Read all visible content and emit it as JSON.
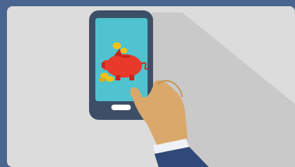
{
  "scene": {
    "icons": [
      "smartphone-icon",
      "piggy-bank-icon",
      "coin-icon",
      "hand-icon"
    ],
    "colors": {
      "frame": "#4a6590",
      "panel": "#dcdcdc",
      "shadow": "#c7c7c7",
      "phone_body": "#3d4f66",
      "screen": "#4fc3cf",
      "piggy": "#e8392b",
      "coin": "#f2c21b",
      "skin": "#d9a86a",
      "sleeve": "#2f4a78",
      "cuff": "#eef1f5"
    }
  }
}
